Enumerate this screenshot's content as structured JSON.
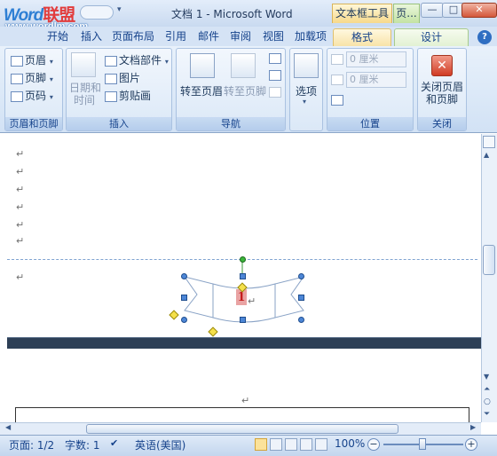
{
  "titlebar": {
    "logo_word": "Word",
    "logo_lm": "联盟",
    "logo_url": "www.wordlm.com",
    "doc_title": "文档 1 - Microsoft Word",
    "context_tab_textbox": "文本框工具",
    "context_tab_hf": "页...",
    "qat_arrow": "▾",
    "min_label": "—",
    "max_label": "□",
    "close_label": "✕"
  },
  "ribbon_tabs": {
    "start": "开始",
    "insert": "插入",
    "layout": "页面布局",
    "references": "引用",
    "mailings": "邮件",
    "review": "审阅",
    "view": "视图",
    "addins": "加载项",
    "format": "格式",
    "design": "设计",
    "help": "?"
  },
  "groups": {
    "hf": {
      "title": "页眉和页脚",
      "header": "页眉",
      "footer": "页脚",
      "pagenum": "页码"
    },
    "insert": {
      "title": "插入",
      "datetime_line1": "日期和",
      "datetime_line2": "时间",
      "docparts": "文档部件",
      "picture": "图片",
      "clipart": "剪贴画"
    },
    "nav": {
      "title": "导航",
      "goto_header": "转至页眉",
      "goto_footer": "转至页脚"
    },
    "options": {
      "label": "选项"
    },
    "position": {
      "title": "位置",
      "header_dist": "0 厘米",
      "footer_dist": "0 厘米"
    },
    "close": {
      "title": "关闭",
      "line1": "关闭页眉",
      "line2": "和页脚"
    }
  },
  "document": {
    "para_mark": "↵",
    "page_number": "1"
  },
  "statusbar": {
    "page": "页面: 1/2",
    "words": "字数: 1",
    "language": "英语(美国)",
    "zoom": "100%",
    "zoom_minus": "−",
    "zoom_plus": "+"
  },
  "colors": {
    "titlebar": "#c9daf0",
    "ribbon": "#d2e2f5",
    "accent": "#15428b",
    "page_separator": "#2d3f56",
    "close_button": "#d03c24"
  }
}
